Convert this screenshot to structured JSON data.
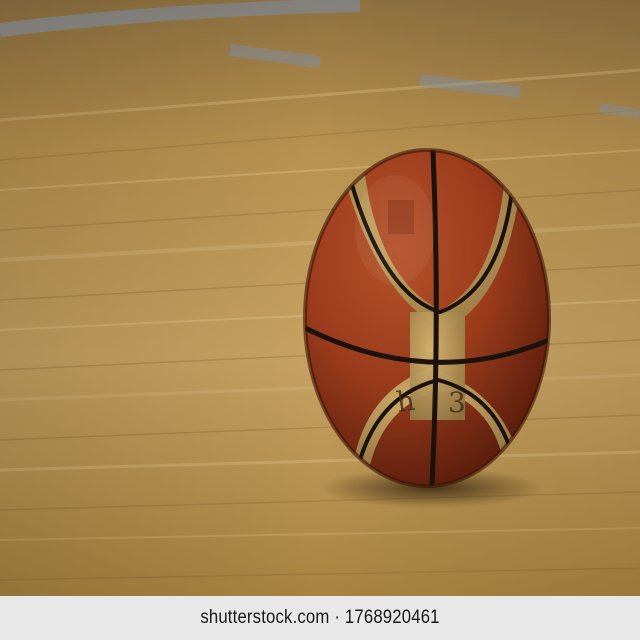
{
  "photo": {
    "subject": "basketball",
    "ball_icon": "basketball-icon",
    "colors": {
      "floor_light": "#c9a462",
      "floor_mid": "#a9844a",
      "floor_dark": "#7a5c2c",
      "court_line": "#7b8fb0",
      "ball_leather": "#a4401f",
      "ball_shadow": "#5e1f0e",
      "ball_panel": "#c9a45e",
      "ball_seam": "#1a120c"
    }
  },
  "watermark": {
    "text": "shutterstock.com · 1768920461"
  }
}
